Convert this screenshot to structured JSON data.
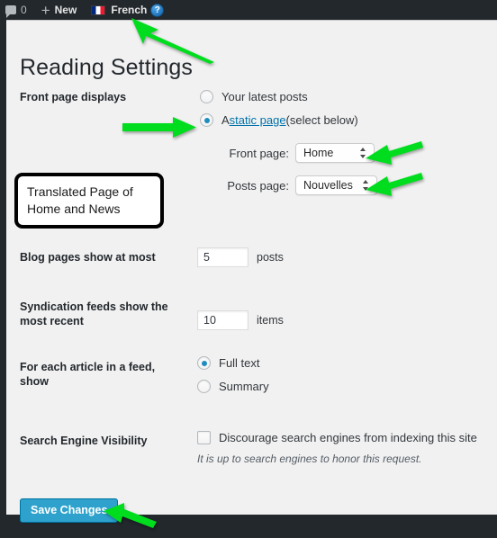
{
  "adminbar": {
    "comment_icon": "comment-bubble-icon",
    "comment_count": "0",
    "new_label": "New",
    "language_label": "French",
    "help_label": "?"
  },
  "page": {
    "title": "Reading Settings"
  },
  "front_page_displays": {
    "label": "Front page displays",
    "options": [
      {
        "label": "Your latest posts",
        "checked": false
      },
      {
        "label_prefix": "A ",
        "link": "static page",
        "label_suffix": " (select below)",
        "checked": true
      }
    ],
    "front_page": {
      "caption": "Front page:",
      "value": "Home"
    },
    "posts_page": {
      "caption": "Posts page:",
      "value": "Nouvelles"
    }
  },
  "blog_pages": {
    "label": "Blog pages show at most",
    "value": "5",
    "suffix": "posts"
  },
  "syndication": {
    "label": "Syndication feeds show the most recent",
    "value": "10",
    "suffix": "items"
  },
  "feed_article": {
    "label": "For each article in a feed, show",
    "options": [
      {
        "label": "Full text",
        "checked": true
      },
      {
        "label": "Summary",
        "checked": false
      }
    ]
  },
  "search_visibility": {
    "label": "Search Engine Visibility",
    "checkbox_label": "Discourage search engines from indexing this site",
    "checked": false,
    "note": "It is up to search engines to honor this request."
  },
  "actions": {
    "save_label": "Save Changes"
  },
  "annotation": {
    "callout_text": "Translated Page of Home and News",
    "arrow_color": "#00dd1e"
  }
}
